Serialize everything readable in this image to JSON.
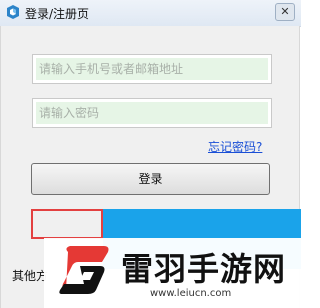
{
  "window": {
    "title": "登录/注册页",
    "close_label": "✕"
  },
  "form": {
    "phone_placeholder": "请输入手机号或者邮箱地址",
    "password_placeholder": "请输入密码",
    "forgot_label": "忘记密码?",
    "login_label": "登录",
    "other_label": "其他方"
  },
  "watermark": {
    "brand_cn": "雷羽手游网",
    "brand_url": "www.leiucn.com"
  },
  "colors": {
    "accent_blue": "#1aa3ea",
    "highlight_red": "#e34040",
    "link_blue": "#1a4fd6",
    "field_green": "#e6f5e6"
  },
  "icons": {
    "app": "app-logo-icon",
    "close": "close-icon",
    "watermark": "leiyu-logo-icon"
  }
}
